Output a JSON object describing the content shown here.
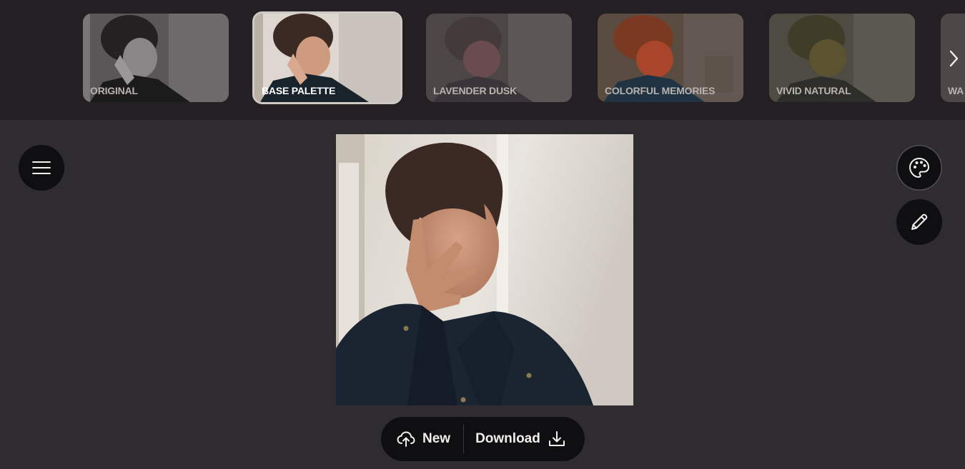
{
  "filters": [
    {
      "label": "ORIGINAL",
      "selected": false
    },
    {
      "label": "BASE PALETTE",
      "selected": true
    },
    {
      "label": "LAVENDER DUSK",
      "selected": false
    },
    {
      "label": "COLORFUL MEMORIES",
      "selected": false
    },
    {
      "label": "VIVID NATURAL",
      "selected": false
    },
    {
      "label": "WA",
      "selected": false
    }
  ],
  "icons": {
    "menu": "menu-icon",
    "palette": "palette-icon",
    "edit": "pencil-icon",
    "next": "chevron-right-icon",
    "upload": "cloud-upload-icon",
    "download": "download-icon"
  },
  "actions": {
    "new_label": "New",
    "download_label": "Download"
  },
  "colors": {
    "background": "#2e2c2f",
    "strip": "#231f22",
    "button": "#0f0e10",
    "text": "#f2efec"
  }
}
